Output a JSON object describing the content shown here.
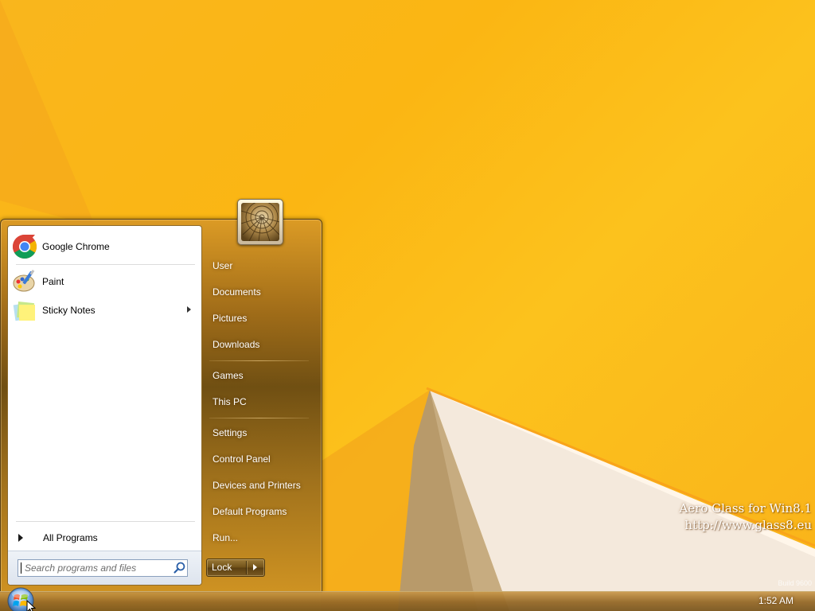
{
  "desktop": {
    "wallpaper_color": "#fbb613",
    "watermark": {
      "line1": "Aero Glass for Win8.1",
      "line2": "http://www.glass8.eu"
    },
    "build_tag": "Build 9600"
  },
  "start_menu": {
    "pinned_programs": [
      {
        "label": "Google Chrome",
        "icon": "chrome-icon",
        "has_submenu": false
      },
      {
        "label": "Paint",
        "icon": "paint-icon",
        "has_submenu": false
      },
      {
        "label": "Sticky Notes",
        "icon": "sticky-notes-icon",
        "has_submenu": true
      }
    ],
    "all_programs_label": "All Programs",
    "search": {
      "placeholder": "Search programs and files",
      "value": ""
    },
    "user_picture": "user-avatar",
    "right_items": {
      "user": "User",
      "documents": "Documents",
      "pictures": "Pictures",
      "downloads": "Downloads",
      "games": "Games",
      "this_pc": "This PC",
      "settings": "Settings",
      "control_panel": "Control Panel",
      "devices_printers": "Devices and Printers",
      "default_programs": "Default Programs",
      "run": "Run..."
    },
    "power_button": {
      "label": "Lock"
    },
    "accent_color": "#8a6320"
  },
  "taskbar": {
    "clock": "1:52 AM",
    "start_button": "windows-orb-icon"
  }
}
